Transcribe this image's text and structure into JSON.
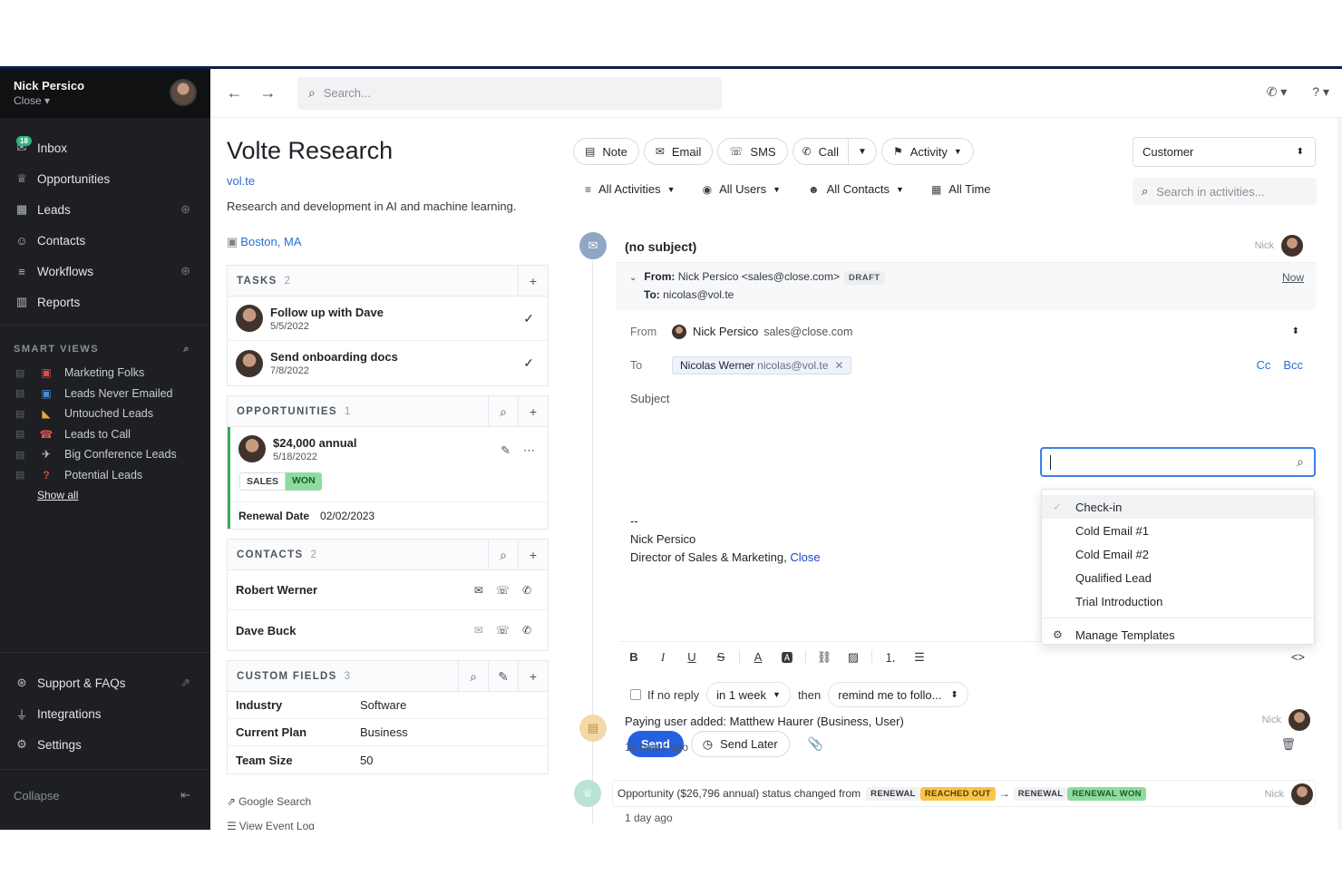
{
  "user": {
    "name": "Nick Persico",
    "org": "Close ▾"
  },
  "nav": [
    {
      "label": "Inbox",
      "icon": "inbox-icon",
      "glyph": "✉",
      "badge": "18"
    },
    {
      "label": "Opportunities",
      "icon": "trophy-icon",
      "glyph": "♕"
    },
    {
      "label": "Leads",
      "icon": "building-icon",
      "glyph": "▦"
    },
    {
      "label": "Contacts",
      "icon": "person-icon",
      "glyph": "☺"
    },
    {
      "label": "Workflows",
      "icon": "workflow-icon",
      "glyph": "≡"
    },
    {
      "label": "Reports",
      "icon": "chart-icon",
      "glyph": "▥"
    }
  ],
  "smart_views": {
    "heading": "SMART VIEWS",
    "items": [
      {
        "label": "Marketing Folks",
        "emoji": "🎒"
      },
      {
        "label": "Leads Never Emailed",
        "emoji": "📪"
      },
      {
        "label": "Untouched Leads",
        "emoji": "📂"
      },
      {
        "label": "Leads to Call",
        "emoji": "☎"
      },
      {
        "label": "Big Conference Leads",
        "emoji": "✈"
      },
      {
        "label": "Potential Leads",
        "emoji": "❓"
      }
    ],
    "show_all": "Show all"
  },
  "bottom_nav": [
    {
      "label": "Support & FAQs",
      "icon": "help-icon"
    },
    {
      "label": "Integrations",
      "icon": "plug-icon"
    },
    {
      "label": "Settings",
      "icon": "gear-icon"
    }
  ],
  "collapse": "Collapse",
  "search_placeholder": "Search...",
  "lead": {
    "name": "Volte Research",
    "url": "vol.te",
    "description": "Research and development in AI and machine learning.",
    "location": "Boston, MA"
  },
  "tasks": {
    "heading": "TASKS",
    "count": "2",
    "items": [
      {
        "title": "Follow up with Dave",
        "date": "5/5/2022"
      },
      {
        "title": "Send onboarding docs",
        "date": "7/8/2022"
      }
    ]
  },
  "opportunities": {
    "heading": "OPPORTUNITIES",
    "count": "1",
    "item": {
      "value": "$24,000 annual",
      "date": "5/18/2022",
      "pipeline": "SALES",
      "status": "WON",
      "renewal_label": "Renewal Date",
      "renewal_date": "02/02/2023"
    }
  },
  "contacts": {
    "heading": "CONTACTS",
    "count": "2",
    "items": [
      {
        "name": "Robert Werner"
      },
      {
        "name": "Dave Buck"
      }
    ]
  },
  "custom_fields": {
    "heading": "CUSTOM FIELDS",
    "count": "3",
    "rows": [
      {
        "key": "Industry",
        "value": "Software"
      },
      {
        "key": "Current Plan",
        "value": "Business"
      },
      {
        "key": "Team Size",
        "value": "50"
      }
    ]
  },
  "links": {
    "google": "Google Search",
    "event_log": "View Event Log"
  },
  "toolbar": {
    "note": "Note",
    "email": "Email",
    "sms": "SMS",
    "call": "Call",
    "activity": "Activity"
  },
  "status_select": "Customer",
  "filters": {
    "activities": "All Activities",
    "users": "All Users",
    "contacts": "All Contacts",
    "time": "All Time"
  },
  "activity_search_placeholder": "Search in activities...",
  "email": {
    "subject_title": "(no subject)",
    "owner": "Nick",
    "from_label": "From:",
    "from_value": "Nick Persico <sales@close.com>",
    "draft": "DRAFT",
    "to_label": "To:",
    "to_value": "nicolas@vol.te",
    "time": "Now",
    "field_from": "From",
    "sender_name": "Nick Persico",
    "sender_email": "sales@close.com",
    "field_to": "To",
    "recipient_name": "Nicolas Werner",
    "recipient_email": "nicolas@vol.te",
    "cc": "Cc",
    "bcc": "Bcc",
    "subject_placeholder": "Subject",
    "sig_dash": "--",
    "sig_name": "Nick Persico",
    "sig_title": "Director of Sales & Marketing,",
    "sig_link": "Close",
    "if_no_reply": "If no reply",
    "delay": "in 1 week",
    "then": "then",
    "followup": "remind me to follo...",
    "send": "Send",
    "send_later": "Send Later"
  },
  "templates": {
    "items": [
      "Check-in",
      "Cold Email #1",
      "Cold Email #2",
      "Qualified Lead",
      "Trial Introduction"
    ],
    "manage": "Manage Templates"
  },
  "activity2": {
    "text": "Paying user added: Matthew Haurer (Business, User)",
    "time": "12 hours ago",
    "owner": "Nick"
  },
  "activity3": {
    "text": "Opportunity ($26,796 annual) status changed from",
    "from_pipeline": "RENEWAL",
    "from_status": "REACHED OUT",
    "to_pipeline": "RENEWAL",
    "to_status": "RENEWAL WON",
    "time": "1 day ago",
    "owner": "Nick"
  },
  "colors": {
    "accent": "#2461e0",
    "won": "#8ddc9d",
    "reached_out": "#f6c54a",
    "sidebar": "#1d1f22"
  }
}
